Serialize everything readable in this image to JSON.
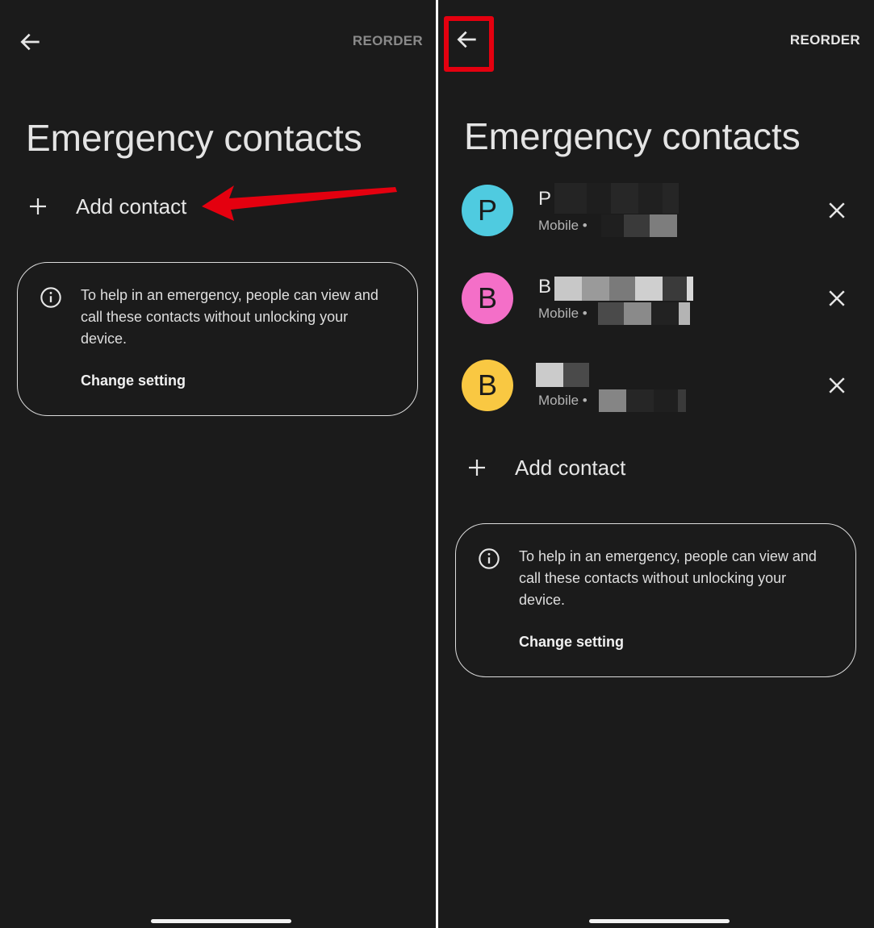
{
  "left_screen": {
    "reorder_label": "REORDER",
    "title": "Emergency contacts",
    "add_contact_label": "Add contact",
    "info_text": "To help in an emergency, people can view and call these contacts without unlocking your device.",
    "change_setting_label": "Change setting"
  },
  "right_screen": {
    "reorder_label": "REORDER",
    "title": "Emergency contacts",
    "contacts": [
      {
        "initial": "P",
        "name_visible": "P",
        "sub": "Mobile •",
        "avatar_color": "#4fcbe0"
      },
      {
        "initial": "B",
        "name_visible": "B",
        "sub": "Mobile •",
        "avatar_color": "#f46fc8"
      },
      {
        "initial": "B",
        "name_visible": "",
        "sub": "Mobile •",
        "avatar_color": "#f9c842"
      }
    ],
    "add_contact_label": "Add contact",
    "info_text": "To help in an emergency, people can view and call these contacts without unlocking your device.",
    "change_setting_label": "Change setting"
  },
  "colors": {
    "background": "#1b1b1b",
    "annotation_red": "#e4000f"
  },
  "icons": [
    "back-arrow-icon",
    "plus-icon",
    "info-icon",
    "close-icon"
  ]
}
